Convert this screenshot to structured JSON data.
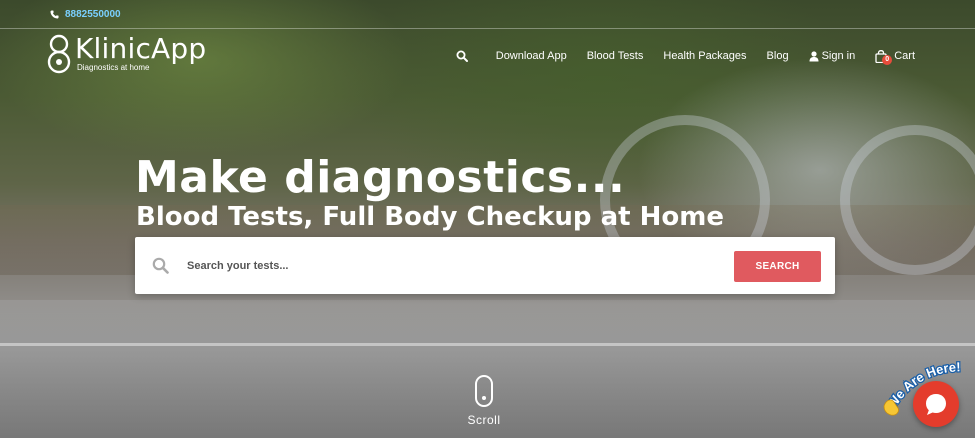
{
  "topbar": {
    "phone": "8882550000",
    "phone_icon": "phone-icon"
  },
  "logo": {
    "name": "KlinicApp",
    "tagline": "Diagnostics at home"
  },
  "nav": {
    "search_icon": "search-icon",
    "items": [
      {
        "label": "Download App"
      },
      {
        "label": "Blood Tests"
      },
      {
        "label": "Health Packages"
      },
      {
        "label": "Blog"
      }
    ],
    "signin_label": "Sign in",
    "cart_label": "Cart",
    "cart_count": "0"
  },
  "hero": {
    "headline": "Make diagnostics...",
    "subline": "Blood Tests, Full Body Checkup at Home"
  },
  "search": {
    "placeholder": "Search your tests...",
    "button_label": "SEARCH"
  },
  "scroll": {
    "label": "Scroll"
  },
  "chat": {
    "banner": "We Are Here!"
  },
  "colors": {
    "accent": "#e05a5f",
    "phone": "#7ad0ff",
    "chat": "#e43c2c"
  }
}
